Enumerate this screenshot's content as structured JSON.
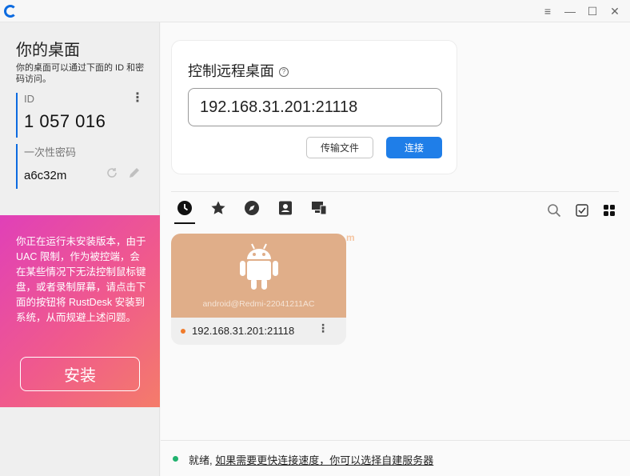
{
  "window": {
    "controls": {
      "menu": "≡",
      "minimize": "—",
      "maximize": "☐",
      "close": "✕"
    }
  },
  "sidebar": {
    "title": "你的桌面",
    "description": "你的桌面可以通过下面的 ID 和密码访问。",
    "id_label": "ID",
    "id_value": "1 057 016",
    "password_label": "一次性密码",
    "password_value": "a6c32m",
    "warning_text": "你正在运行未安装版本，由于 UAC 限制，作为被控端，会在某些情况下无法控制鼠标键盘，或者录制屏幕，请点击下面的按钮将 RustDesk 安装到系统，从而规避上述问题。",
    "install_label": "安装"
  },
  "connect_card": {
    "title": "控制远程桌面",
    "input_value": "192.168.31.201:21118",
    "transfer_label": "传输文件",
    "connect_label": "连接"
  },
  "tabs": [
    {
      "icon": "clock-icon",
      "active": true
    },
    {
      "icon": "star-icon",
      "active": false
    },
    {
      "icon": "compass-icon",
      "active": false
    },
    {
      "icon": "address-book-icon",
      "active": false
    },
    {
      "icon": "devices-icon",
      "active": false
    }
  ],
  "peers": [
    {
      "name": "android@Redmi-22041211AC",
      "address": "192.168.31.201:21118",
      "status_color": "#f07a2a",
      "thumb_color": "#e0ae89"
    }
  ],
  "watermark": "m",
  "status": {
    "prefix": "就绪,",
    "link": "如果需要更快连接速度，你可以选择自建服务器"
  },
  "colors": {
    "accent": "#1f7ee8",
    "online": "#21b26f"
  }
}
